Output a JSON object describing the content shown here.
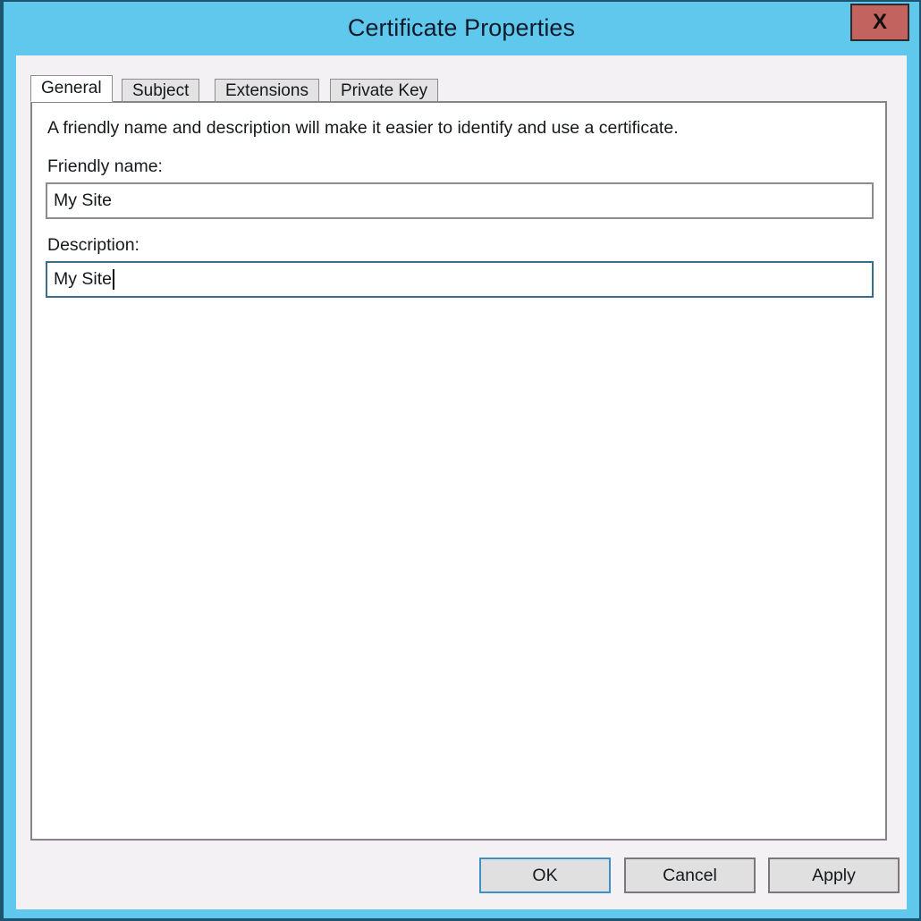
{
  "window": {
    "title": "Certificate Properties",
    "close_label": "X",
    "frame_color": "#5fc8ec",
    "close_color": "#c2635f"
  },
  "tabs": [
    {
      "label": "General",
      "active": true
    },
    {
      "label": "Subject",
      "active": false
    },
    {
      "label": "Extensions",
      "active": false
    },
    {
      "label": "Private Key",
      "active": false
    }
  ],
  "general": {
    "intro": "A friendly name and description will make it easier to identify and use a certificate.",
    "friendly_name": {
      "label": "Friendly name:",
      "value": "My Site",
      "focused": false
    },
    "description": {
      "label": "Description:",
      "value": "My Site",
      "focused": true
    }
  },
  "footer": {
    "ok_label": "OK",
    "cancel_label": "Cancel",
    "apply_label": "Apply"
  }
}
